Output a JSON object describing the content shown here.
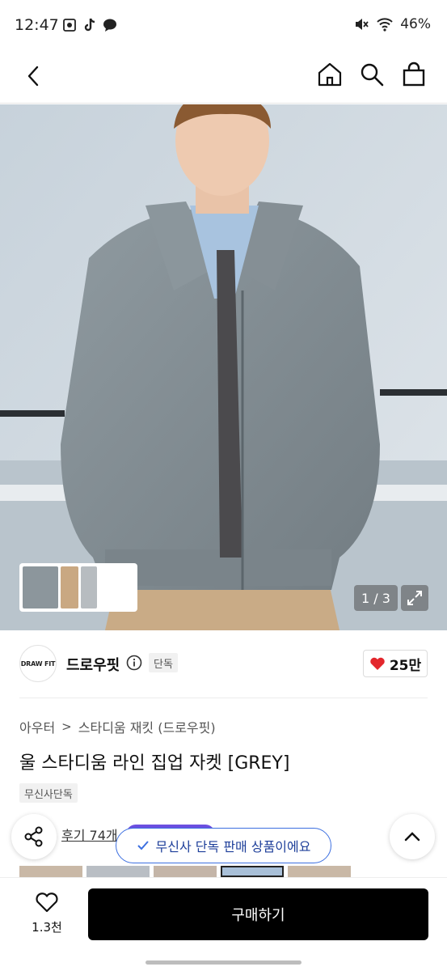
{
  "status": {
    "time": "12:47",
    "battery": "46%"
  },
  "nav": {
    "icons": [
      "back-icon",
      "home-icon",
      "search-icon",
      "shopping-bag-icon"
    ]
  },
  "gallery": {
    "counter": "1 / 3"
  },
  "brand": {
    "logo_text": "DRAW FIT",
    "name": "드로우핏",
    "exclusive_tag": "단독",
    "likes": "25만"
  },
  "product": {
    "breadcrumb": [
      "아우터",
      "스타디움 재킷 (드로우핏)"
    ],
    "title": "울 스타디움 라인 집업 자켓 [GREY]",
    "badge": "무신사단독",
    "review_label": "후기 74개"
  },
  "toast": {
    "text": "무신사 단독 판매 상품이에요"
  },
  "bottom": {
    "wish_count": "1.3천",
    "buy_label": "구매하기"
  },
  "colors": {
    "accent_blue": "#3c6fe0",
    "heart_red": "#e3262c",
    "buy_black": "#000000"
  }
}
